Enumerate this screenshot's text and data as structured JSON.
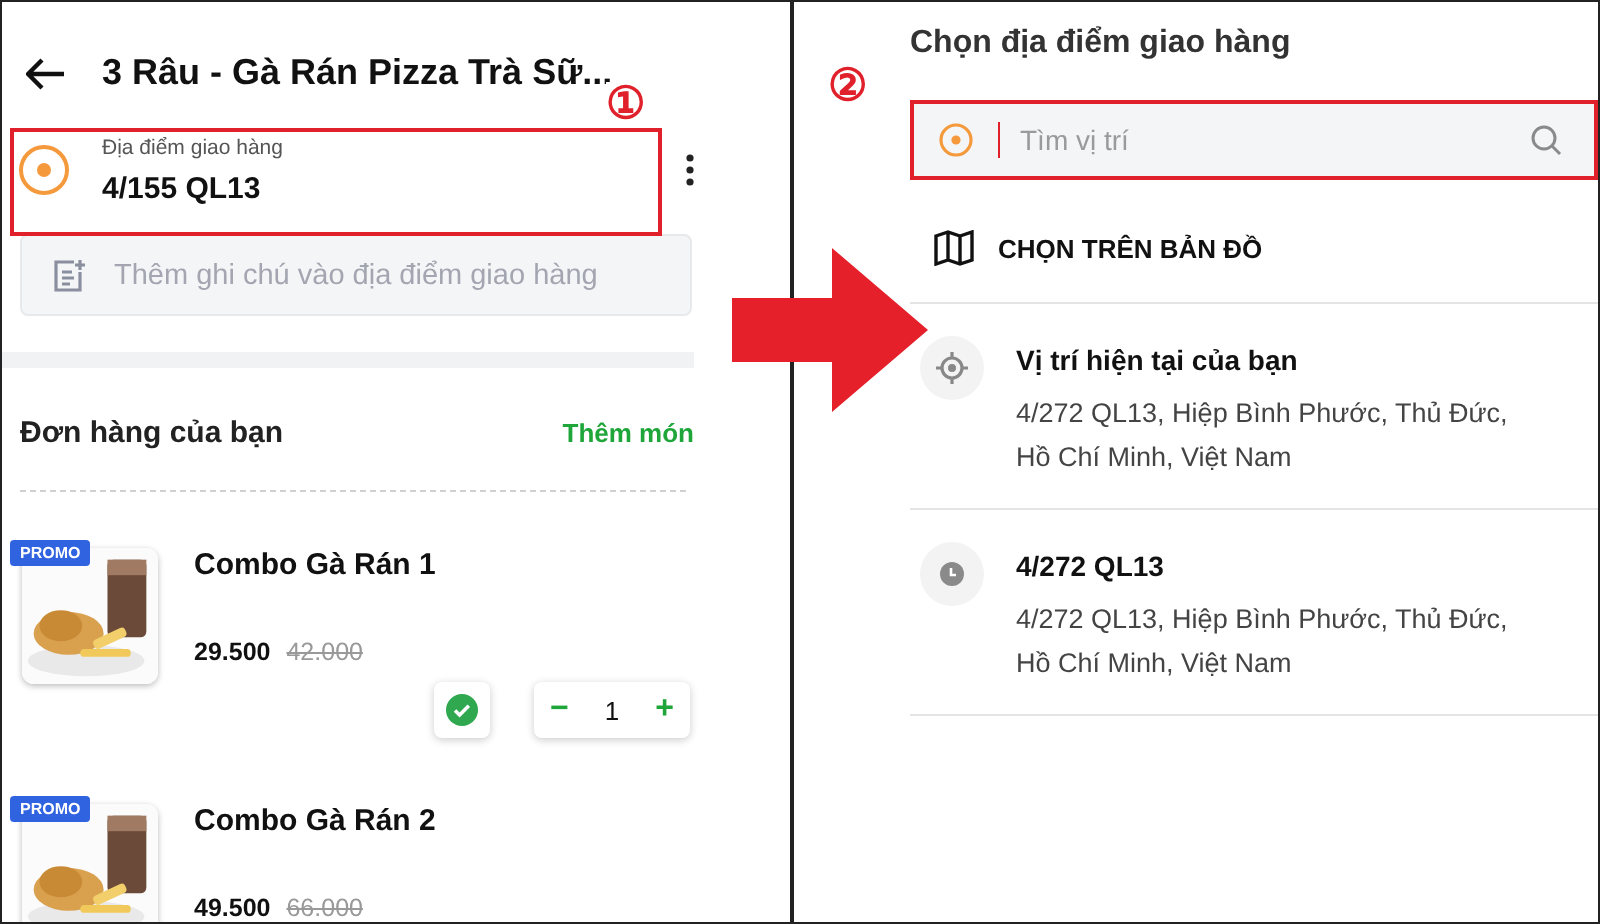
{
  "left": {
    "header": {
      "title": "3 Râu - Gà Rán Pizza Trà Sữ..."
    },
    "marker": "①",
    "address": {
      "label": "Địa điểm giao hàng",
      "value": "4/155 QL13"
    },
    "note": {
      "placeholder": "Thêm ghi chú vào địa điểm giao hàng"
    },
    "order": {
      "title": "Đơn hàng của bạn",
      "add_link": "Thêm món",
      "items": [
        {
          "badge": "PROMO",
          "name": "Combo Gà Rán 1",
          "price": "29.500",
          "old_price": "42.000",
          "controls": {
            "checked": true,
            "minus": "−",
            "quantity": "1",
            "plus": "+"
          }
        },
        {
          "badge": "PROMO",
          "name": "Combo Gà Rán 2",
          "price": "49.500",
          "old_price": "66.000"
        }
      ]
    }
  },
  "right": {
    "title": "Chọn địa điểm giao hàng",
    "marker": "②",
    "search": {
      "placeholder": "Tìm vị trí"
    },
    "map_option": "CHỌN TRÊN BẢN ĐỒ",
    "places": [
      {
        "kind": "current",
        "name": "Vị trí hiện tại của bạn",
        "address": "4/272 QL13, Hiệp Bình Phước, Thủ Đức, Hồ Chí Minh, Việt Nam"
      },
      {
        "kind": "recent",
        "name": "4/272 QL13",
        "address": "4/272 QL13, Hiệp Bình Phước, Thủ Đức, Hồ Chí Minh, Việt Nam"
      }
    ]
  }
}
